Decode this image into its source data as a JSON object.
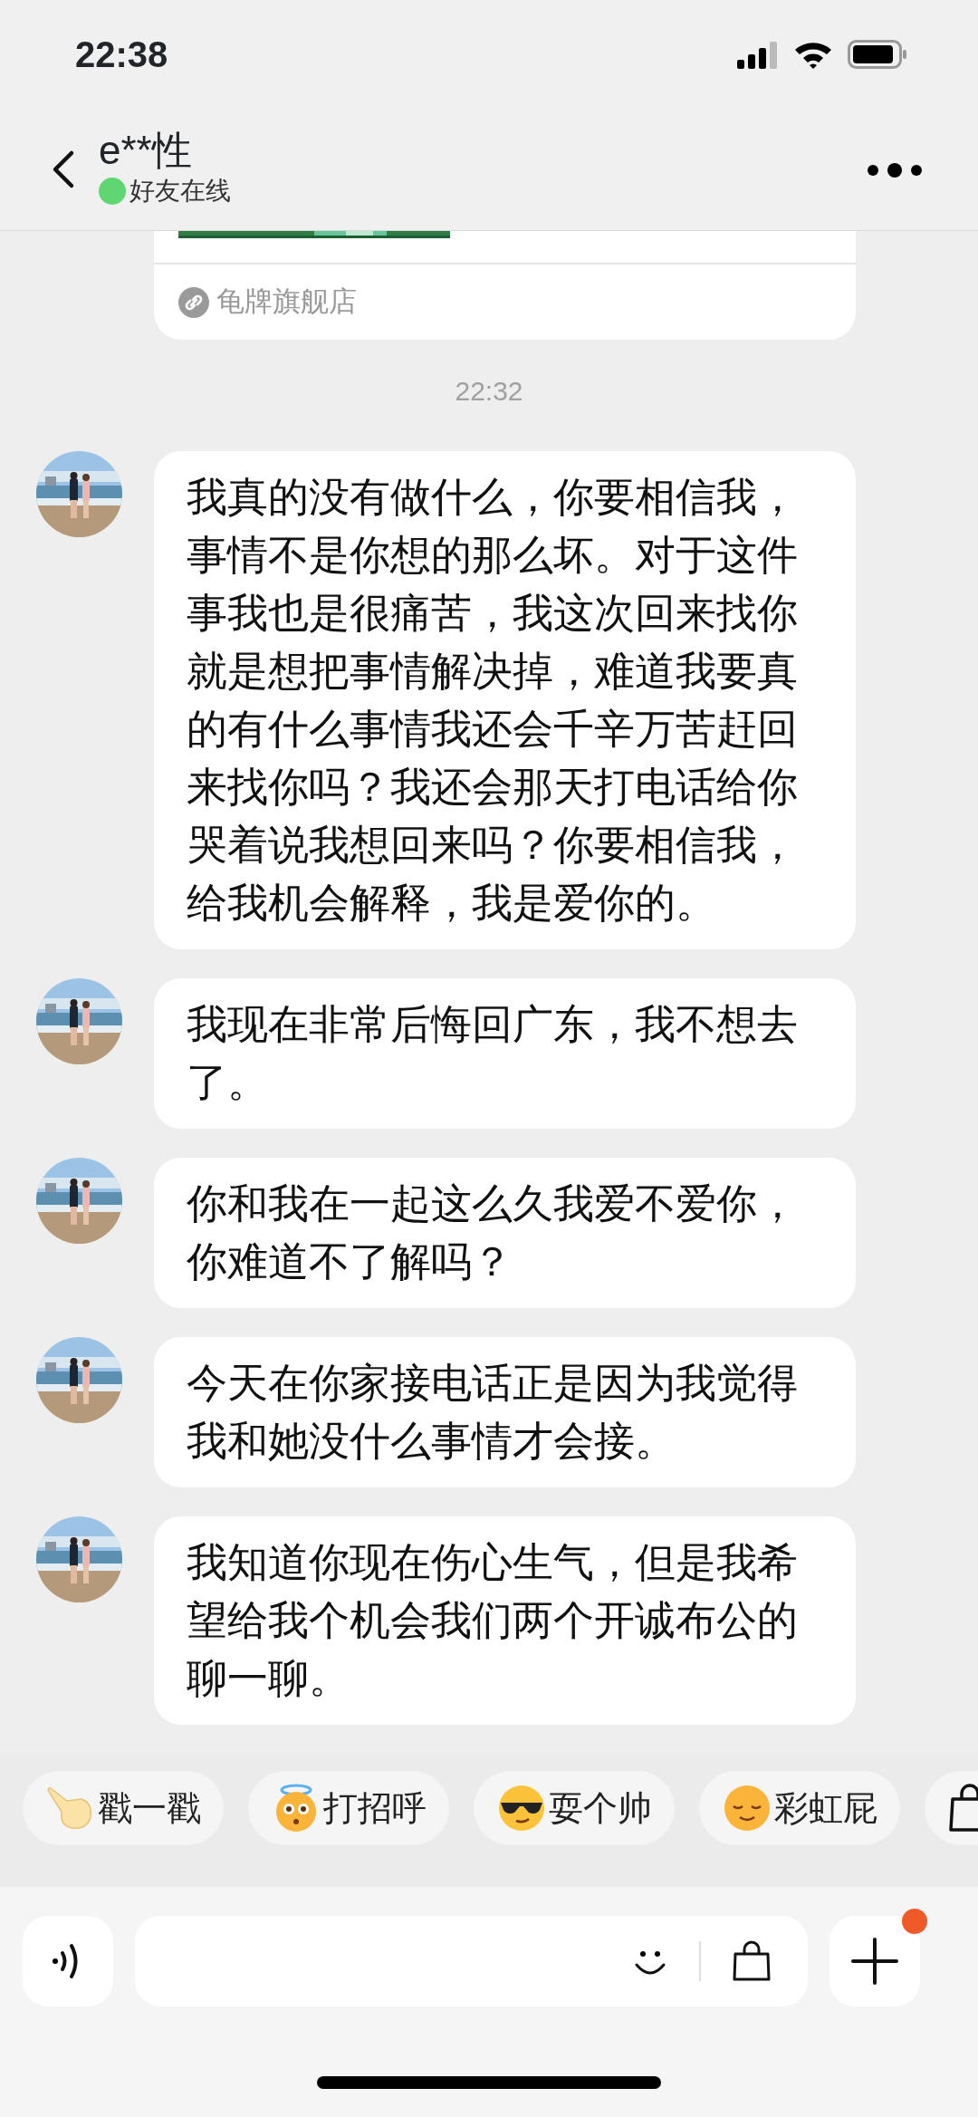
{
  "status_bar": {
    "time": "22:38"
  },
  "header": {
    "title": "e**性",
    "status": "好友在线",
    "online": true
  },
  "product_card": {
    "store": "龟牌旗舰店"
  },
  "timestamp": "22:32",
  "messages": [
    {
      "text": "我真的没有做什么，你要相信我，事情不是你想的那么坏。对于这件事我也是很痛苦，我这次回来找你就是想把事情解决掉，难道我要真的有什么事情我还会千辛万苦赶回来找你吗？我还会那天打电话给你哭着说我想回来吗？你要相信我，给我机会解释，我是爱你的。"
    },
    {
      "text": "我现在非常后悔回广东，我不想去了。"
    },
    {
      "text": "你和我在一起这么久我爱不爱你，你难道不了解吗？"
    },
    {
      "text": "今天在你家接电话正是因为我觉得我和她没什么事情才会接。"
    },
    {
      "text": "我知道你现在伤心生气，但是我希望给我个机会我们两个开诚布公的聊一聊。"
    }
  ],
  "quick_replies": [
    {
      "label": "戳一戳",
      "kind": "poke"
    },
    {
      "label": "打招呼",
      "kind": "greet"
    },
    {
      "label": "耍个帅",
      "kind": "cool"
    },
    {
      "label": "彩虹屁",
      "kind": "praise"
    },
    {
      "kind": "gift"
    }
  ],
  "composer": {
    "badge": true
  }
}
